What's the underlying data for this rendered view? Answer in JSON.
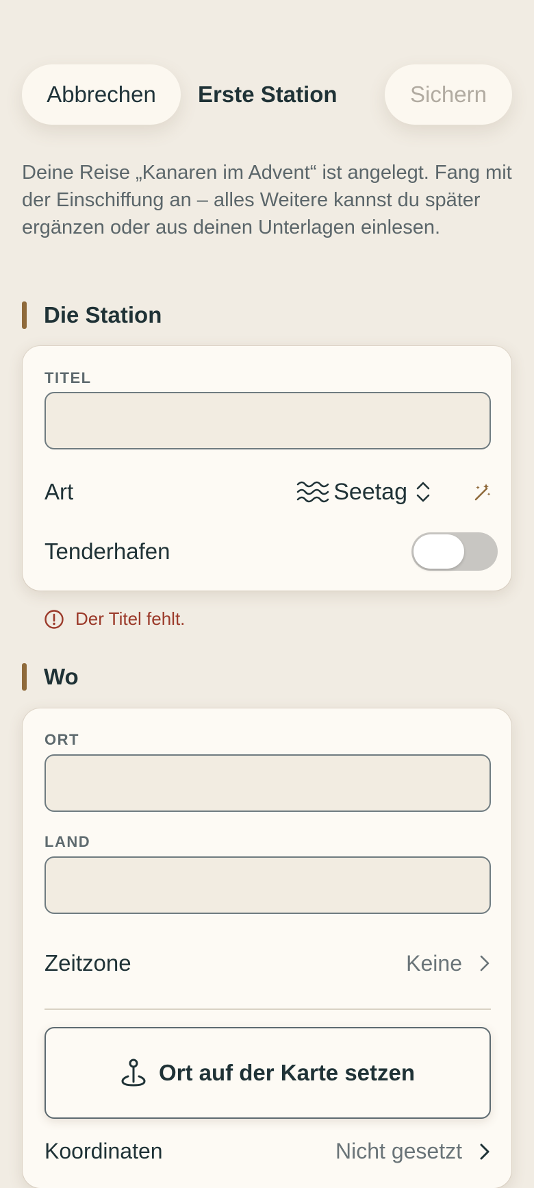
{
  "nav": {
    "cancel_label": "Abbrechen",
    "title": "Erste Station",
    "save_label": "Sichern"
  },
  "intro_text": "Deine Reise „Kanaren im Advent“ ist angelegt. Fang mit der Einschiffung an – alles Weitere kannst du später ergänzen oder aus deinen Unterlagen einlesen.",
  "station_section": {
    "title": "Die Station",
    "title_label": "TITEL",
    "title_value": "",
    "art_label": "Art",
    "art_icon": "waves-icon",
    "art_value": "Seetag",
    "tender_label": "Tenderhafen",
    "tender_on": false,
    "error_text": "Der Titel fehlt."
  },
  "where_section": {
    "title": "Wo",
    "ort_label": "ORT",
    "ort_value": "",
    "land_label": "LAND",
    "land_value": "",
    "timezone_label": "Zeitzone",
    "timezone_value": "Keine",
    "map_button_label": "Ort auf der Karte setzen",
    "map_icon": "map-pin-icon",
    "coordinates_label": "Koordinaten",
    "coordinates_value": "Nicht gesetzt"
  },
  "colors": {
    "background": "#f1ece3",
    "card": "#fdfaf4",
    "accent_bar": "#8f6a3b",
    "error": "#9b3a2a",
    "text": "#1f3236"
  }
}
